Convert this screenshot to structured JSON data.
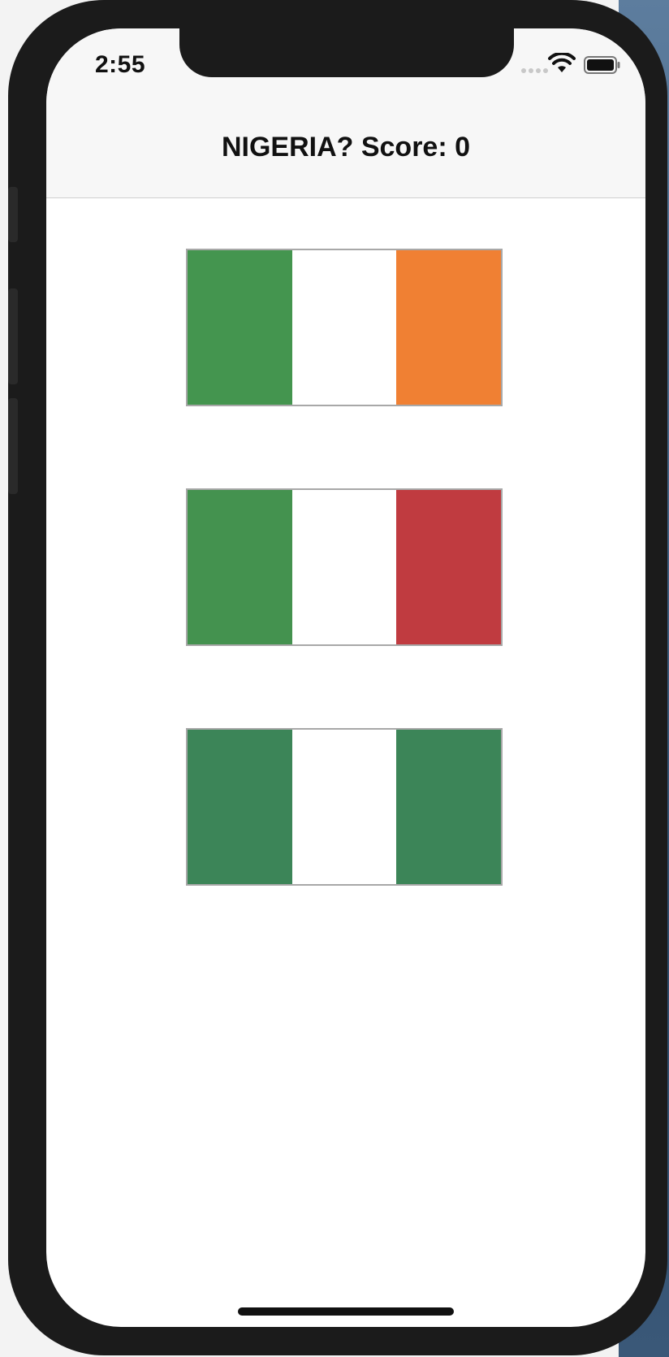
{
  "status_bar": {
    "time": "2:55"
  },
  "navigation": {
    "title": "NIGERIA? Score: 0"
  },
  "flags": [
    {
      "name": "ireland",
      "colors": [
        "#44954f",
        "#ffffff",
        "#f08033"
      ]
    },
    {
      "name": "italy",
      "colors": [
        "#44924f",
        "#ffffff",
        "#c03b40"
      ]
    },
    {
      "name": "nigeria",
      "colors": [
        "#3c8558",
        "#ffffff",
        "#3c8558"
      ]
    }
  ],
  "colors": {
    "nav_background": "#f7f7f7",
    "frame": "#1b1b1b"
  }
}
